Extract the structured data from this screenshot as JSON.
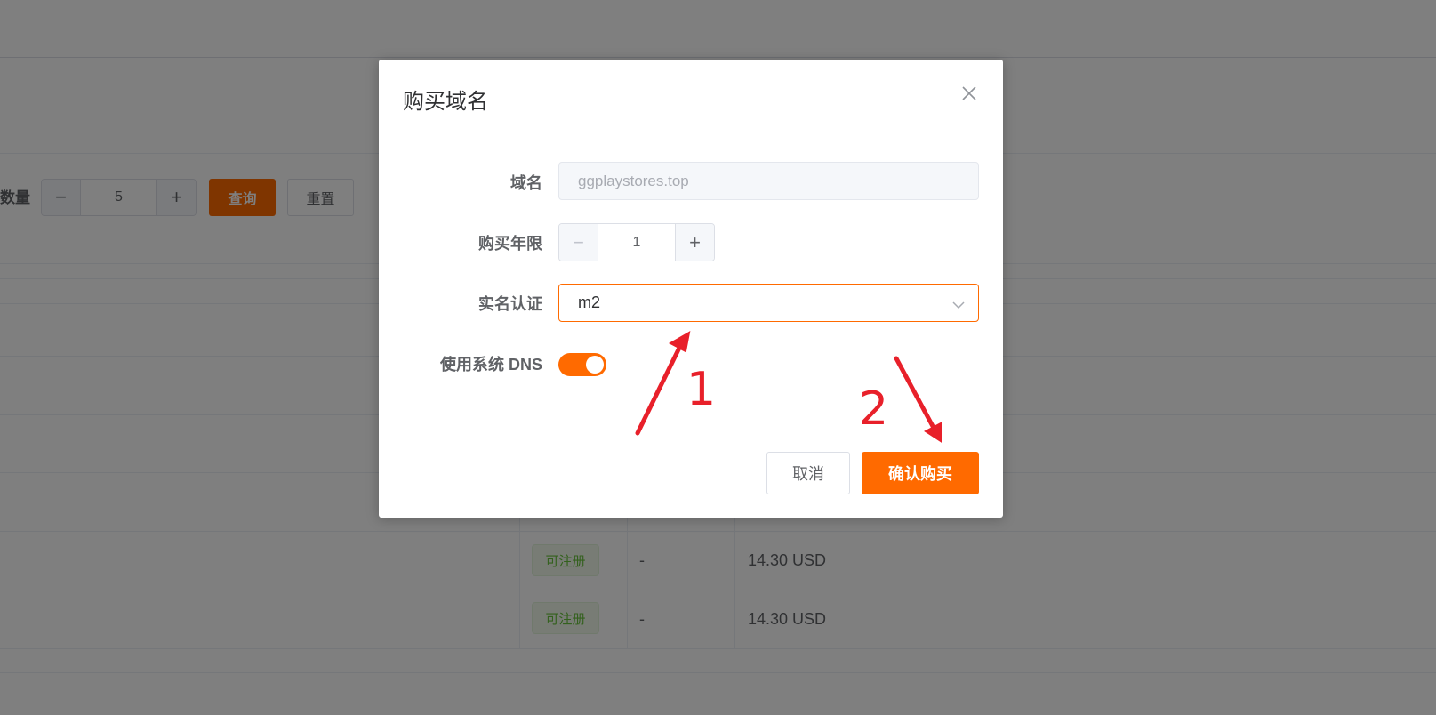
{
  "background": {
    "filter": {
      "quantity_label": "数量",
      "quantity_value": "5",
      "minus": "−",
      "plus": "+",
      "query_label": "查询",
      "reset_label": "重置"
    },
    "rows": [
      {
        "status": "可注册",
        "extra": "-",
        "price": "14.30 USD"
      },
      {
        "status": "可注册",
        "extra": "-",
        "price": "14.30 USD"
      }
    ]
  },
  "dialog": {
    "title": "购买域名",
    "fields": {
      "domain_label": "域名",
      "domain_value": "ggplaystores.top",
      "years_label": "购买年限",
      "years_value": "1",
      "years_minus": "−",
      "years_plus": "+",
      "realname_label": "实名认证",
      "realname_value": "m2",
      "dns_label": "使用系统 DNS",
      "dns_enabled": true
    },
    "buttons": {
      "cancel": "取消",
      "confirm": "确认购买"
    }
  },
  "annotations": {
    "color": "#e8202a",
    "labels": [
      "1",
      "2"
    ]
  },
  "colors": {
    "accent": "#ff6a00",
    "tag_green": "#67c23a"
  }
}
